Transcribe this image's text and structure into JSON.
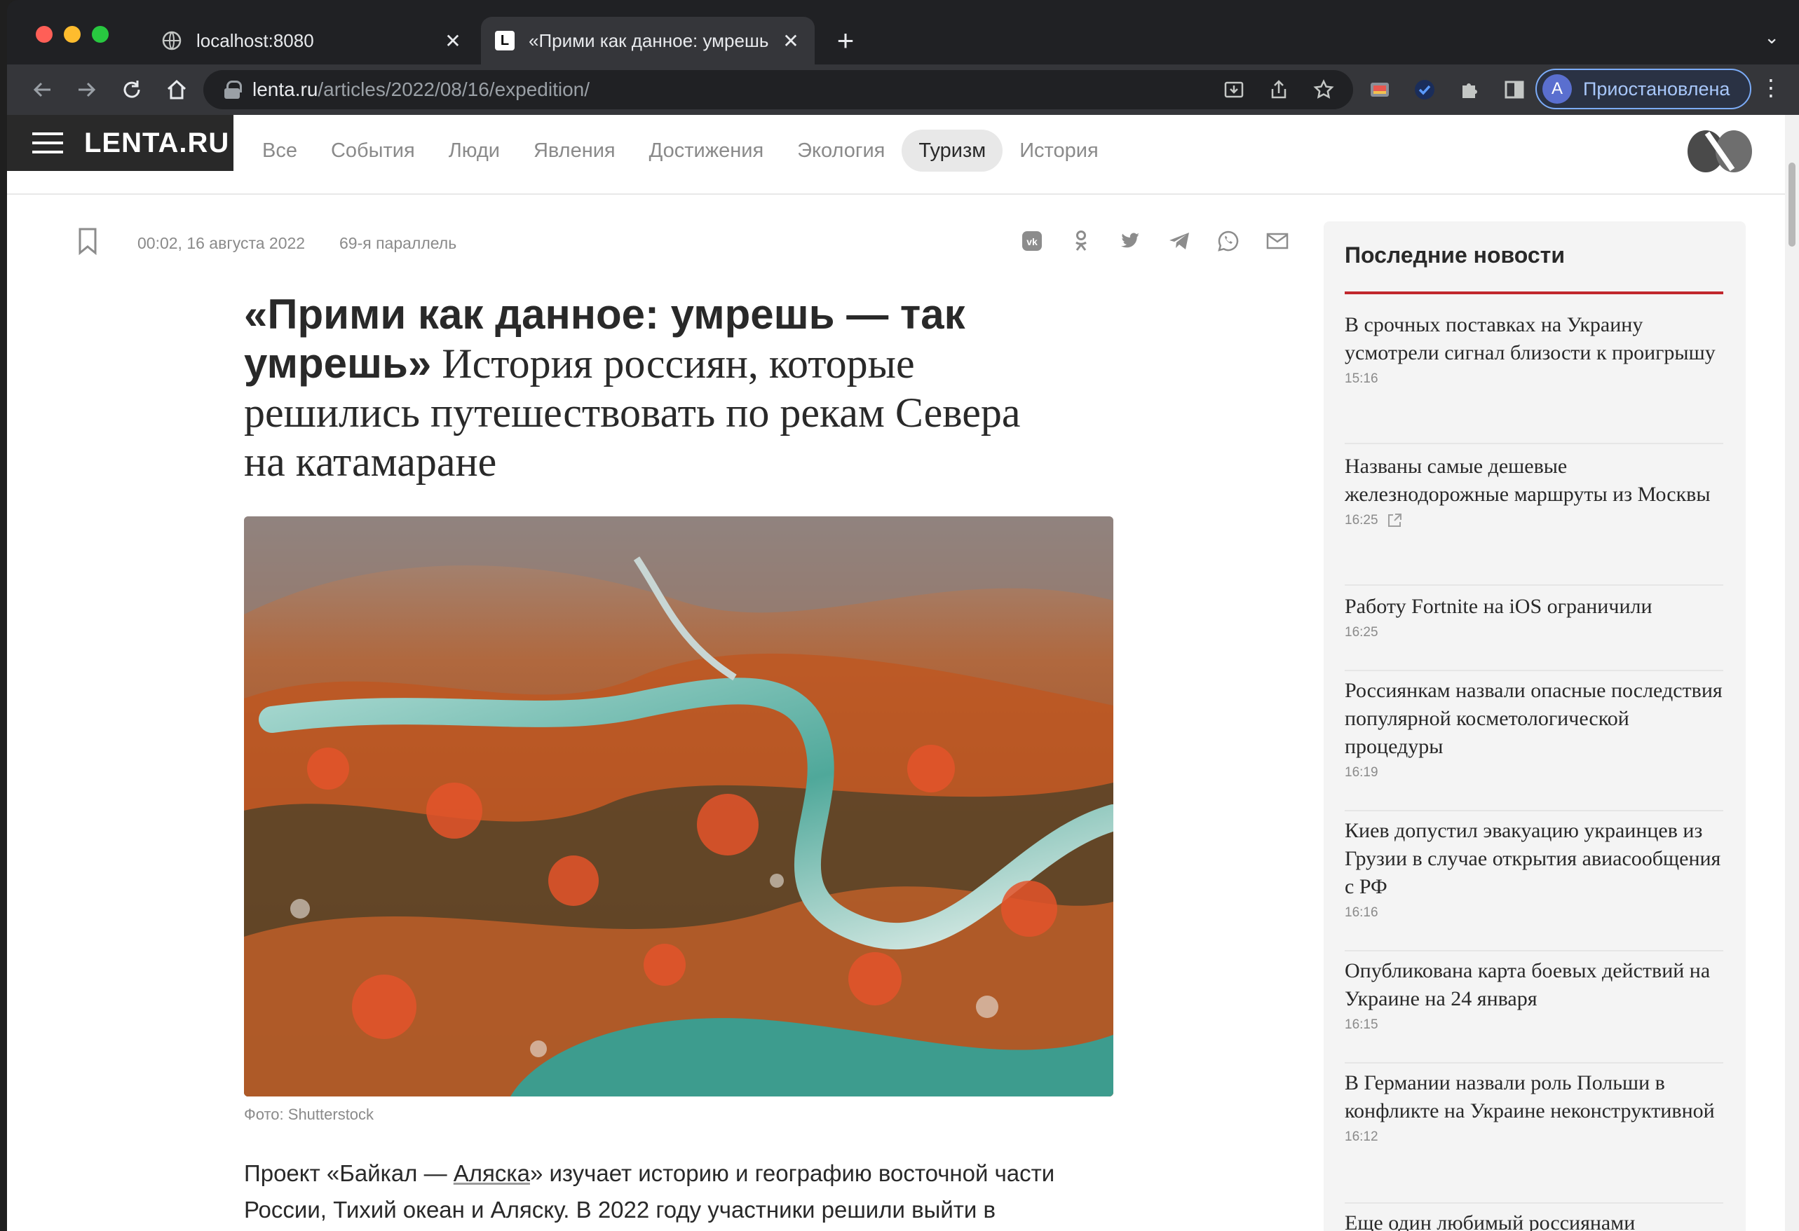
{
  "browser": {
    "tabs": [
      {
        "title": "localhost:8080",
        "close": "✕",
        "favicon": "globe-icon"
      },
      {
        "title": "«Прими как данное: умрешь",
        "close": "✕",
        "favicon": "L"
      }
    ],
    "new_tab": "+",
    "url": {
      "domain": "lenta.ru",
      "path": "/articles/2022/08/16/expedition/"
    },
    "profile": {
      "initial": "A",
      "label": "Приостановлена"
    }
  },
  "site": {
    "logo": "LENTA.RU",
    "rubrics": [
      "Все",
      "События",
      "Люди",
      "Явления",
      "Достижения",
      "Экология",
      "Туризм",
      "История"
    ],
    "active_rubric": "Туризм"
  },
  "article": {
    "date": "00:02, 16 августа 2022",
    "tag": "69-я параллель",
    "title_strong": "«Прими как данное: умрешь — так умрешь»",
    "title_rest": " История россиян, которые решились путешествовать по рекам Севера на катамаране",
    "caption": "Фото: Shutterstock",
    "lead_before": "Проект «Байкал — ",
    "lead_link": "Аляска",
    "lead_after": "» изучает историю и географию восточной части России, Тихий океан и Аляску. В 2022 году участники решили выйти в"
  },
  "sidebar": {
    "title": "Последние новости",
    "news": [
      {
        "title": "В срочных поставках на Украину усмотрели сигнал близости к проигрышу",
        "time": "15:16"
      },
      {
        "title": "Названы самые дешевые железнодорожные маршруты из Москвы",
        "time": "16:25"
      },
      {
        "title": "Работу Fortnite на iOS ограничили",
        "time": "16:25"
      },
      {
        "title": "Россиянкам назвали опасные последствия популярной косметологической процедуры",
        "time": "16:19"
      },
      {
        "title": "Киев допустил эвакуацию украинцев из Грузии в случае открытия авиасообщения с РФ",
        "time": "16:16"
      },
      {
        "title": "Опубликована карта боевых действий на Украине на 24 января",
        "time": "16:15"
      },
      {
        "title": "В Германии назвали роль Польши в конфликте на Украине неконструктивной",
        "time": "16:12"
      },
      {
        "title": "Еще один любимый россиянами",
        "time": ""
      }
    ]
  },
  "colors": {
    "accent": "#c1272d",
    "header_dark": "#292929",
    "profile_border": "#7cacf8"
  }
}
